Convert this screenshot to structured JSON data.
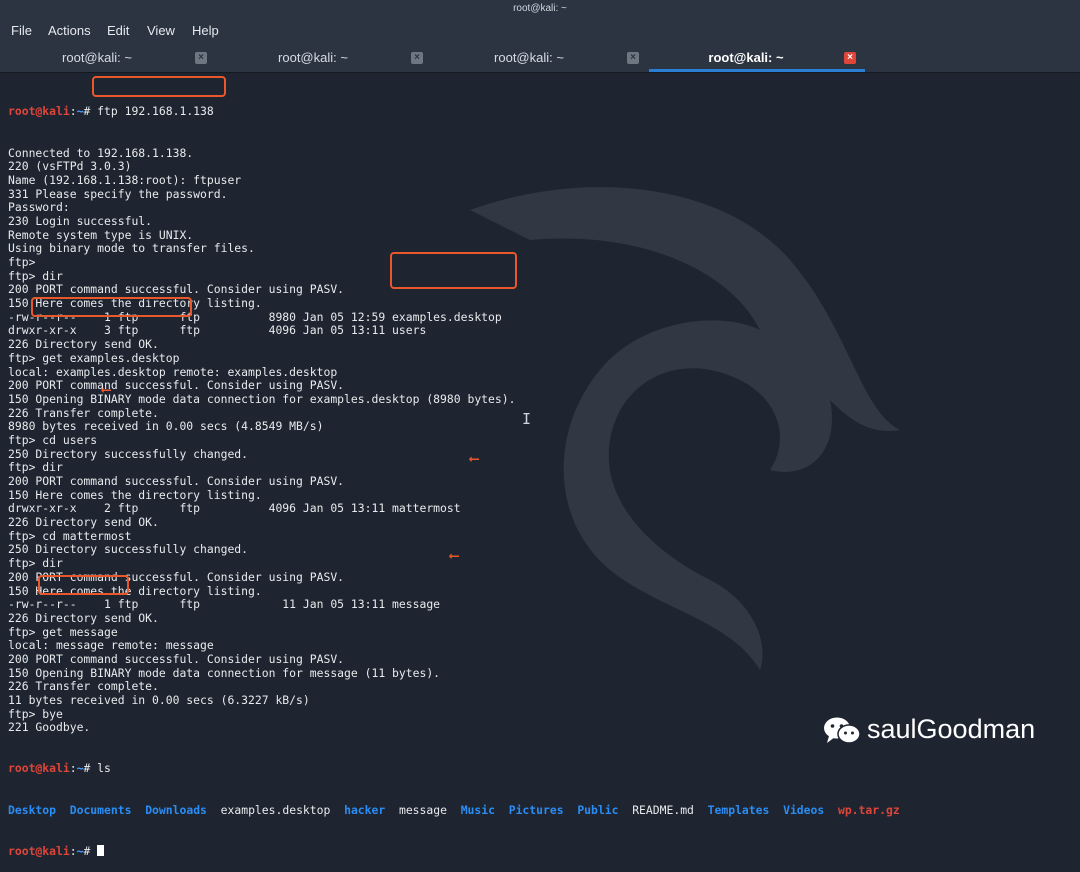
{
  "window": {
    "title": "root@kali: ~"
  },
  "menu": [
    "File",
    "Actions",
    "Edit",
    "View",
    "Help"
  ],
  "tabs": [
    {
      "label": "root@kali: ~",
      "close": "×"
    },
    {
      "label": "root@kali: ~",
      "close": "×"
    },
    {
      "label": "root@kali: ~",
      "close": "×"
    },
    {
      "label": "root@kali: ~",
      "close": "×"
    }
  ],
  "prompt": {
    "user": "root@kali",
    "colon": ":",
    "path": "~",
    "symbol": "# "
  },
  "commands": {
    "first": "ftp 192.168.1.138",
    "ls": "ls"
  },
  "output": [
    "Connected to 192.168.1.138.",
    "220 (vsFTPd 3.0.3)",
    "Name (192.168.1.138:root): ftpuser",
    "331 Please specify the password.",
    "Password:",
    "230 Login successful.",
    "Remote system type is UNIX.",
    "Using binary mode to transfer files.",
    "ftp>",
    "ftp> dir",
    "200 PORT command successful. Consider using PASV.",
    "150 Here comes the directory listing.",
    "-rw-r--r--    1 ftp      ftp          8980 Jan 05 12:59 examples.desktop",
    "drwxr-xr-x    3 ftp      ftp          4096 Jan 05 13:11 users",
    "226 Directory send OK.",
    "ftp> get examples.desktop",
    "local: examples.desktop remote: examples.desktop",
    "200 PORT command successful. Consider using PASV.",
    "150 Opening BINARY mode data connection for examples.desktop (8980 bytes).",
    "226 Transfer complete.",
    "8980 bytes received in 0.00 secs (4.8549 MB/s)",
    "ftp> cd users",
    "250 Directory successfully changed.",
    "ftp> dir",
    "200 PORT command successful. Consider using PASV.",
    "150 Here comes the directory listing.",
    "drwxr-xr-x    2 ftp      ftp          4096 Jan 05 13:11 mattermost",
    "226 Directory send OK.",
    "ftp> cd mattermost",
    "250 Directory successfully changed.",
    "ftp> dir",
    "200 PORT command successful. Consider using PASV.",
    "150 Here comes the directory listing.",
    "-rw-r--r--    1 ftp      ftp            11 Jan 05 13:11 message",
    "226 Directory send OK.",
    "ftp> get message",
    "local: message remote: message",
    "200 PORT command successful. Consider using PASV.",
    "150 Opening BINARY mode data connection for message (11 bytes).",
    "226 Transfer complete.",
    "11 bytes received in 0.00 secs (6.3227 kB/s)",
    "ftp> bye",
    "221 Goodbye."
  ],
  "ls_entries": [
    {
      "name": "Desktop",
      "type": "dir"
    },
    {
      "name": "Documents",
      "type": "dir"
    },
    {
      "name": "Downloads",
      "type": "dir"
    },
    {
      "name": "examples.desktop",
      "type": "file"
    },
    {
      "name": "hacker",
      "type": "dir"
    },
    {
      "name": "message",
      "type": "file"
    },
    {
      "name": "Music",
      "type": "dir"
    },
    {
      "name": "Pictures",
      "type": "dir"
    },
    {
      "name": "Public",
      "type": "dir"
    },
    {
      "name": "README.md",
      "type": "file"
    },
    {
      "name": "Templates",
      "type": "dir"
    },
    {
      "name": "Videos",
      "type": "dir"
    },
    {
      "name": "wp.tar.gz",
      "type": "archive"
    }
  ],
  "watermark": {
    "text": "saulGoodman"
  },
  "colors": {
    "accent": "#2a7fd4",
    "highlight": "#e8582b",
    "prompt_red": "#e0453a",
    "dir_blue": "#2a8df5"
  }
}
